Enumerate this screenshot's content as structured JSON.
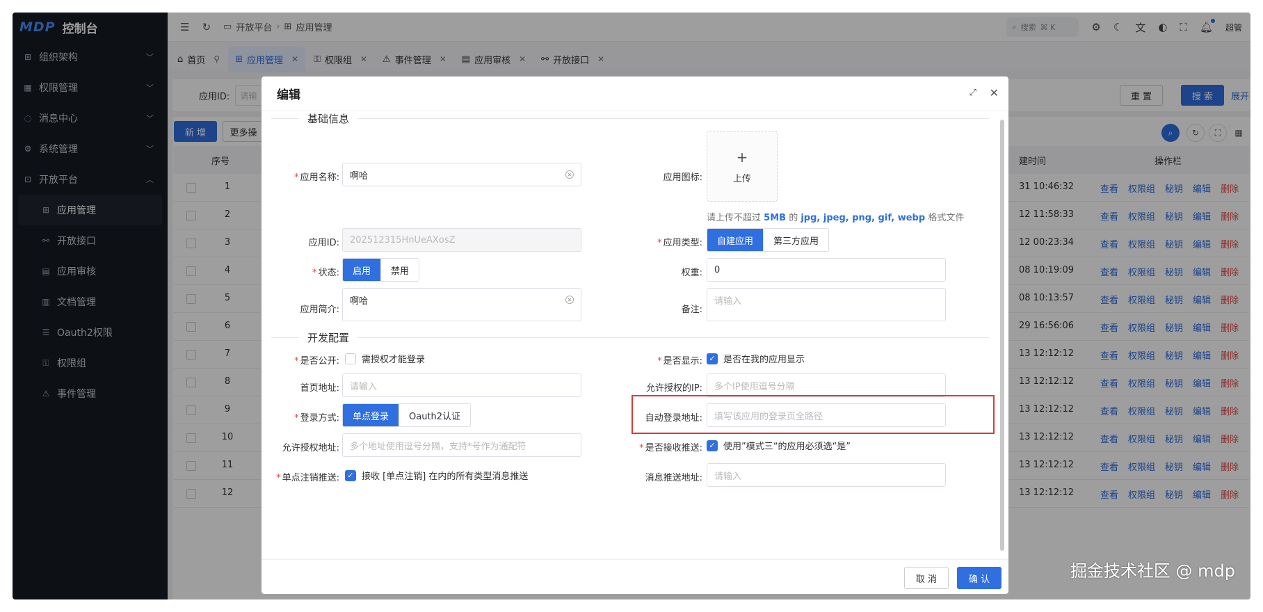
{
  "app": {
    "logo_mark": "MDP",
    "title": "控制台"
  },
  "sidebar": {
    "items": [
      {
        "label": "组织架构",
        "icon": "org-icon",
        "expandable": true
      },
      {
        "label": "权限管理",
        "icon": "permission-icon",
        "expandable": true
      },
      {
        "label": "消息中心",
        "icon": "message-icon",
        "expandable": true
      },
      {
        "label": "系统管理",
        "icon": "gear-icon",
        "expandable": true
      },
      {
        "label": "开放平台",
        "icon": "open-platform-icon",
        "expandable": true,
        "expanded": true
      }
    ],
    "subitems": [
      {
        "label": "应用管理",
        "icon": "app-icon",
        "active": true
      },
      {
        "label": "开放接口",
        "icon": "link-icon"
      },
      {
        "label": "应用审核",
        "icon": "audit-icon"
      },
      {
        "label": "文档管理",
        "icon": "doc-icon"
      },
      {
        "label": "Oauth2权限",
        "icon": "list-icon"
      },
      {
        "label": "权限组",
        "icon": "key-icon"
      },
      {
        "label": "事件管理",
        "icon": "warning-icon"
      }
    ]
  },
  "topbar": {
    "breadcrumb": [
      "开放平台",
      "应用管理"
    ],
    "search_label": "搜索",
    "search_shortcut": "⌘ K",
    "user": "超管"
  },
  "tabs": [
    {
      "label": "首页",
      "icon": "home-icon"
    },
    {
      "label": "应用管理",
      "icon": "app-icon",
      "active": true
    },
    {
      "label": "权限组",
      "icon": "key-icon"
    },
    {
      "label": "事件管理",
      "icon": "warning-icon"
    },
    {
      "label": "应用审核",
      "icon": "audit-icon"
    },
    {
      "label": "开放接口",
      "icon": "link-icon"
    }
  ],
  "filter": {
    "app_id_label": "应用ID:",
    "app_id_placeholder": "请输",
    "reset": "重 置",
    "search": "搜 索",
    "expand": "展开"
  },
  "table": {
    "add": "新 增",
    "more": "更多操",
    "headers": {
      "index": "序号",
      "time": "建时间",
      "ops": "操作栏"
    },
    "ops": [
      "查看",
      "权限组",
      "秘钥",
      "编辑",
      "删除"
    ],
    "rows": [
      {
        "index": "1",
        "time": "31 10:46:32"
      },
      {
        "index": "2",
        "time": "12 11:58:33"
      },
      {
        "index": "3",
        "time": "12 00:23:34"
      },
      {
        "index": "4",
        "time": "08 10:19:09"
      },
      {
        "index": "5",
        "time": "08 10:13:57"
      },
      {
        "index": "6",
        "time": "29 16:56:06"
      },
      {
        "index": "7",
        "time": "13 12:12:12"
      },
      {
        "index": "8",
        "time": "13 12:12:12"
      },
      {
        "index": "9",
        "time": "13 12:12:12"
      },
      {
        "index": "10",
        "time": "13 12:12:12"
      },
      {
        "index": "11",
        "time": "13 12:12:12"
      },
      {
        "index": "12",
        "time": "13 12:12:12"
      }
    ]
  },
  "modal": {
    "title": "编辑",
    "section_basic": "基础信息",
    "section_dev": "开发配置",
    "app_name_label": "应用名称:",
    "app_name_value": "啊哈",
    "app_icon_label": "应用图标:",
    "upload_label": "上传",
    "upload_hint_pre": "请上传不超过",
    "upload_hint_size": "5MB",
    "upload_hint_mid": "的",
    "upload_hint_types": "jpg, jpeg, png, gif, webp",
    "upload_hint_post": "格式文件",
    "app_id_label": "应用ID:",
    "app_id_value": "202512315HnUeAXosZ",
    "app_type_label": "应用类型:",
    "app_type_options": [
      "自建应用",
      "第三方应用"
    ],
    "status_label": "状态:",
    "status_options": [
      "启用",
      "禁用"
    ],
    "weight_label": "权重:",
    "weight_value": "0",
    "intro_label": "应用简介:",
    "intro_value": "啊哈",
    "remark_label": "备注:",
    "remark_placeholder": "请输入",
    "public_label": "是否公开:",
    "public_checkbox": "需授权才能登录",
    "public_checked": false,
    "display_label": "是否显示:",
    "display_checkbox": "是否在我的应用显示",
    "display_checked": true,
    "homepage_label": "首页地址:",
    "homepage_placeholder": "请输入",
    "allowed_ip_label": "允许授权的IP:",
    "allowed_ip_placeholder": "多个IP使用逗号分隔",
    "login_mode_label": "登录方式:",
    "login_mode_options": [
      "单点登录",
      "Oauth2认证"
    ],
    "auto_login_label": "自动登录地址:",
    "auto_login_placeholder": "填写该应用的登录页全路径",
    "allowed_addr_label": "允许授权地址:",
    "allowed_addr_placeholder": "多个地址使用逗号分隔，支持*号作为通配符",
    "receive_push_label": "是否接收推送:",
    "receive_push_checkbox": "使用”模式三“的应用必须选“是”",
    "receive_push_checked": true,
    "sso_logout_label": "单点注销推送:",
    "sso_logout_checkbox": "接收 [单点注销] 在内的所有类型消息推送",
    "sso_logout_checked": true,
    "msg_push_label": "消息推送地址:",
    "msg_push_placeholder": "请输入",
    "cancel": "取 消",
    "confirm": "确 认"
  },
  "watermark": "掘金技术社区 @ mdp",
  "colors": {
    "primary": "#2f6fe0",
    "danger": "#e04848",
    "sidebar": "#161b22"
  }
}
